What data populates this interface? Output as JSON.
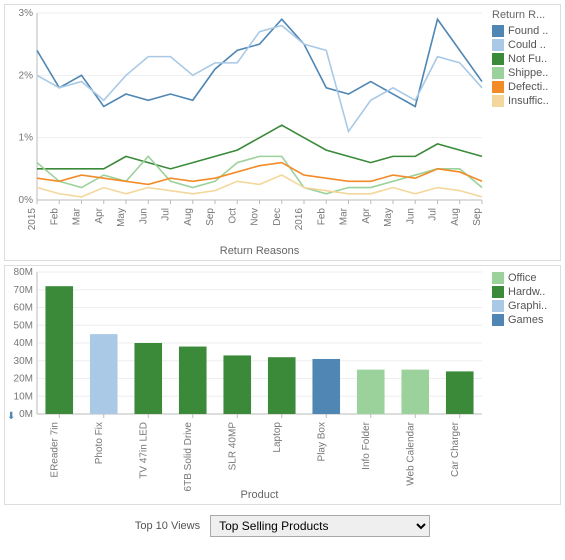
{
  "chart_data": [
    {
      "type": "line",
      "title": "Return Reasons",
      "xlabel": "Return Reasons",
      "ylabel": "",
      "ylim": [
        0,
        3
      ],
      "y_format": "percent",
      "legend_title": "Return R...",
      "categories": [
        "2015",
        "Feb",
        "Mar",
        "Apr",
        "May",
        "Jun",
        "Jul",
        "Aug",
        "Sep",
        "Oct",
        "Nov",
        "Dec",
        "2016",
        "Feb",
        "Mar",
        "Apr",
        "May",
        "Jun",
        "Jul",
        "Aug",
        "Sep"
      ],
      "series": [
        {
          "name": "Found ..",
          "color": "#4f86b3",
          "values": [
            2.4,
            1.8,
            2.0,
            1.5,
            1.7,
            1.6,
            1.7,
            1.6,
            2.1,
            2.4,
            2.5,
            2.9,
            2.5,
            1.8,
            1.7,
            1.9,
            1.7,
            1.5,
            2.9,
            2.4,
            1.9
          ]
        },
        {
          "name": "Could ..",
          "color": "#a9c9e6",
          "values": [
            2.0,
            1.8,
            1.9,
            1.6,
            2.0,
            2.3,
            2.3,
            2.0,
            2.2,
            2.2,
            2.7,
            2.8,
            2.5,
            2.4,
            1.1,
            1.6,
            1.8,
            1.6,
            2.3,
            2.2,
            1.8
          ]
        },
        {
          "name": "Not Fu..",
          "color": "#3a8a3a",
          "values": [
            0.5,
            0.5,
            0.5,
            0.5,
            0.7,
            0.6,
            0.5,
            0.6,
            0.7,
            0.8,
            1.0,
            1.2,
            1.0,
            0.8,
            0.7,
            0.6,
            0.7,
            0.7,
            0.9,
            0.8,
            0.7
          ]
        },
        {
          "name": "Shippe..",
          "color": "#9bd29b",
          "values": [
            0.6,
            0.3,
            0.2,
            0.4,
            0.3,
            0.7,
            0.3,
            0.2,
            0.3,
            0.6,
            0.7,
            0.7,
            0.2,
            0.1,
            0.2,
            0.2,
            0.3,
            0.4,
            0.5,
            0.5,
            0.2
          ]
        },
        {
          "name": "Defecti..",
          "color": "#f28c28",
          "values": [
            0.35,
            0.3,
            0.4,
            0.35,
            0.3,
            0.25,
            0.35,
            0.3,
            0.35,
            0.45,
            0.55,
            0.6,
            0.4,
            0.35,
            0.3,
            0.3,
            0.4,
            0.35,
            0.5,
            0.45,
            0.3
          ]
        },
        {
          "name": "Insuffic..",
          "color": "#f4d79c",
          "values": [
            0.2,
            0.1,
            0.05,
            0.2,
            0.1,
            0.2,
            0.15,
            0.1,
            0.15,
            0.3,
            0.25,
            0.4,
            0.2,
            0.15,
            0.1,
            0.1,
            0.2,
            0.1,
            0.2,
            0.15,
            0.05
          ]
        }
      ]
    },
    {
      "type": "bar",
      "title": "Product",
      "xlabel": "Product",
      "ylabel": "",
      "ylim": [
        0,
        80
      ],
      "y_unit": "M",
      "legend_title": "",
      "categories": [
        "EReader 7in",
        "Photo Fix",
        "TV 47in LED",
        "6TB Solid Drive",
        "SLR 40MP",
        "Laptop",
        "Play Box",
        "Info Folder",
        "Web Calendar",
        "Car Charger"
      ],
      "values": [
        72,
        45,
        40,
        38,
        33,
        32,
        31,
        25,
        25,
        24
      ],
      "category_group": [
        "Hardw..",
        "Graphi..",
        "Hardw..",
        "Hardw..",
        "Hardw..",
        "Hardw..",
        "Games",
        "Office",
        "Office",
        "Hardw.."
      ],
      "legend_items": [
        {
          "name": "Office",
          "color": "#9bd29b"
        },
        {
          "name": "Hardw..",
          "color": "#3a8a3a"
        },
        {
          "name": "Graphi..",
          "color": "#a9c9e6"
        },
        {
          "name": "Games",
          "color": "#4f86b3"
        }
      ]
    }
  ],
  "footer": {
    "label": "Top 10 Views",
    "dropdown_selected": "Top Selling Products"
  },
  "download_icon": "⬇"
}
